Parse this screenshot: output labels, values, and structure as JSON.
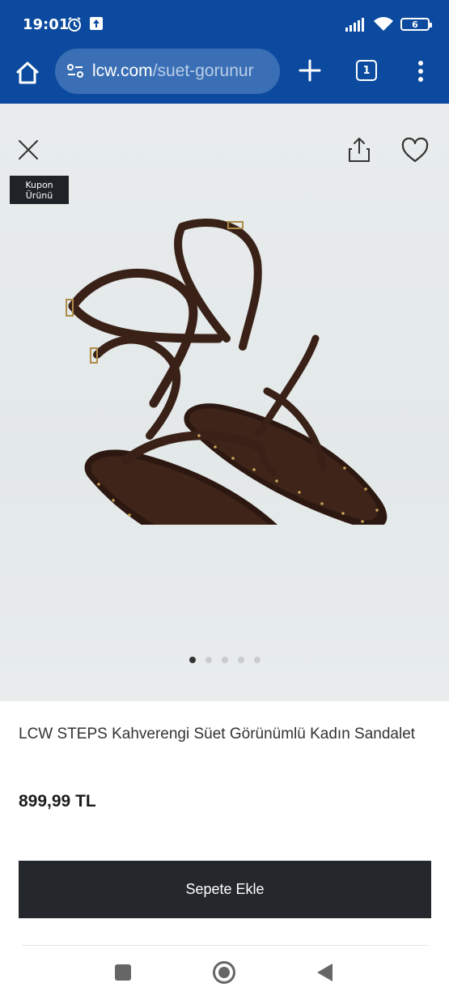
{
  "status_bar": {
    "time": "19:01",
    "battery": "6"
  },
  "browser": {
    "url_domain": "lcw.com",
    "url_path": "/suet-gorunur",
    "tab_count": "1",
    "icons": [
      "home-icon",
      "site-settings-icon",
      "plus-icon",
      "tabs-icon",
      "more-vert-icon"
    ]
  },
  "product": {
    "badge_line1": "Kupon",
    "badge_line2": "Ürünü",
    "title": "LCW STEPS Kahverengi Süet Görünümlü Kadın Sandalet",
    "price": "899,99 TL",
    "add_to_cart": "Sepete Ekle",
    "gallery_count": 5,
    "gallery_active_index": 0
  },
  "colors": {
    "browser_bg": "#0b4a9e",
    "button_bg": "#24272b",
    "image_bg": "#e5e9e9",
    "sandal_brown": "#3e2419"
  }
}
